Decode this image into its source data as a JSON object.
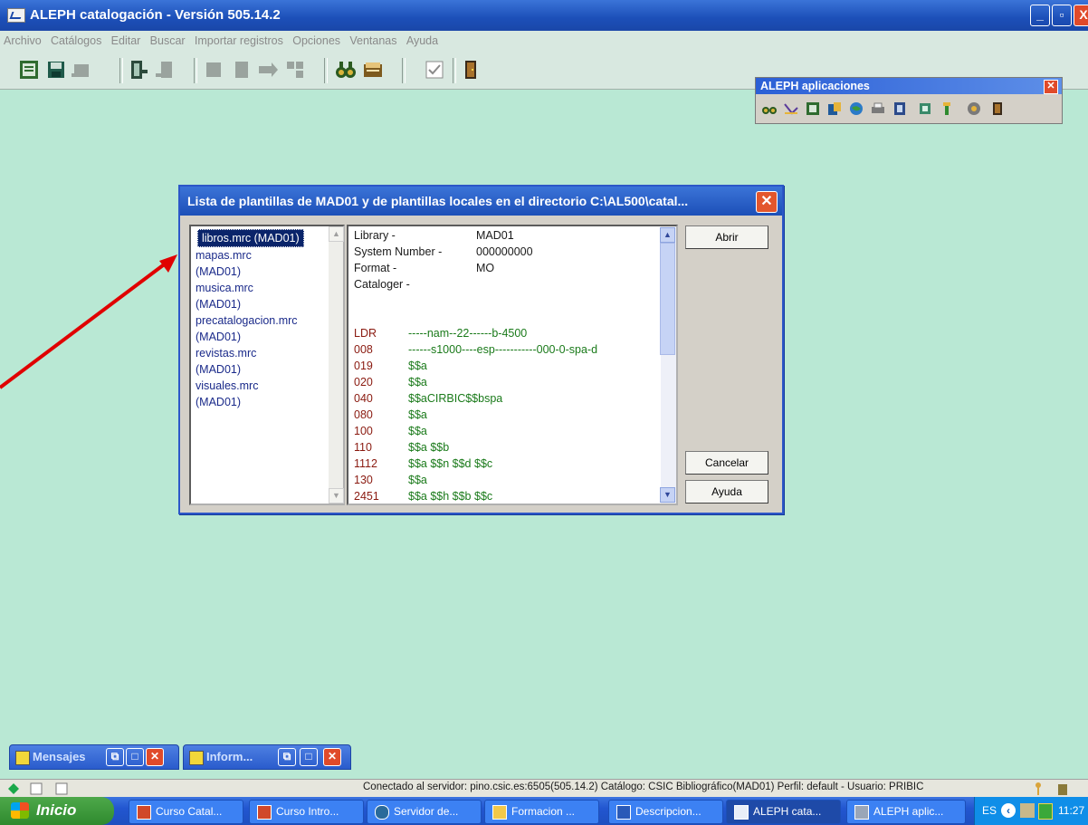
{
  "window": {
    "title": "ALEPH catalogación - Versión 505.14.2",
    "controls": [
      "_",
      "▫",
      "X"
    ]
  },
  "menu": [
    "Archivo",
    "Catálogos",
    "Editar",
    "Buscar",
    "Importar registros",
    "Opciones",
    "Ventanas",
    "Ayuda"
  ],
  "appbar": {
    "title": "ALEPH aplicaciones",
    "close": "✕"
  },
  "dialog": {
    "title": "Lista de plantillas de MAD01 y de plantillas locales en el directorio C:\\AL500\\catal...",
    "close": "✕",
    "templates": [
      "libros.mrc (MAD01)",
      "mapas.mrc",
      "(MAD01)",
      "musica.mrc",
      "(MAD01)",
      "precatalogacion.mrc",
      "(MAD01)",
      "revistas.mrc",
      "(MAD01)",
      "visuales.mrc",
      "(MAD01)"
    ],
    "header": [
      {
        "label": "Library -",
        "value": "MAD01"
      },
      {
        "label": "System Number -",
        "value": "000000000"
      },
      {
        "label": "Format -",
        "value": "MO"
      },
      {
        "label": "Cataloger -",
        "value": ""
      }
    ],
    "fields": [
      {
        "tag": "LDR",
        "value": "-----nam--22------b-4500"
      },
      {
        "tag": "008",
        "value": "------s1000----esp-----------000-0-spa-d"
      },
      {
        "tag": "019",
        "value": "$$a"
      },
      {
        "tag": "020",
        "value": "$$a"
      },
      {
        "tag": "040",
        "value": "$$aCIRBIC$$bspa"
      },
      {
        "tag": "080",
        "value": "$$a"
      },
      {
        "tag": "100",
        "value": "$$a"
      },
      {
        "tag": "110",
        "value": "$$a $$b"
      },
      {
        "tag": "1112",
        "value": "$$a $$n $$d $$c"
      },
      {
        "tag": "130",
        "value": "$$a"
      },
      {
        "tag": "2451",
        "value": "$$a $$h $$b $$c"
      }
    ],
    "buttons": {
      "open": "Abrir",
      "cancel": "Cancelar",
      "help": "Ayuda"
    }
  },
  "minimized": [
    {
      "label": "Mensajes"
    },
    {
      "label": "Inform..."
    }
  ],
  "status": {
    "text": "Conectado al servidor: pino.csic.es:6505(505.14.2) Catálogo: CSIC Bibliográfico(MAD01) Perfil: default - Usuario: PRIBIC"
  },
  "taskbar": {
    "start": "Inicio",
    "tasks": [
      {
        "label": "Curso Catal..."
      },
      {
        "label": "Curso Intro..."
      },
      {
        "label": "Servidor de..."
      },
      {
        "label": "Formacion ..."
      },
      {
        "label": "Descripcion..."
      },
      {
        "label": "ALEPH cata..."
      },
      {
        "label": "ALEPH aplic..."
      }
    ],
    "lang": "ES",
    "clock": "11:27"
  },
  "colors": {
    "workspace": "#b9e8d4",
    "annotation_arrow": "#e00000"
  }
}
